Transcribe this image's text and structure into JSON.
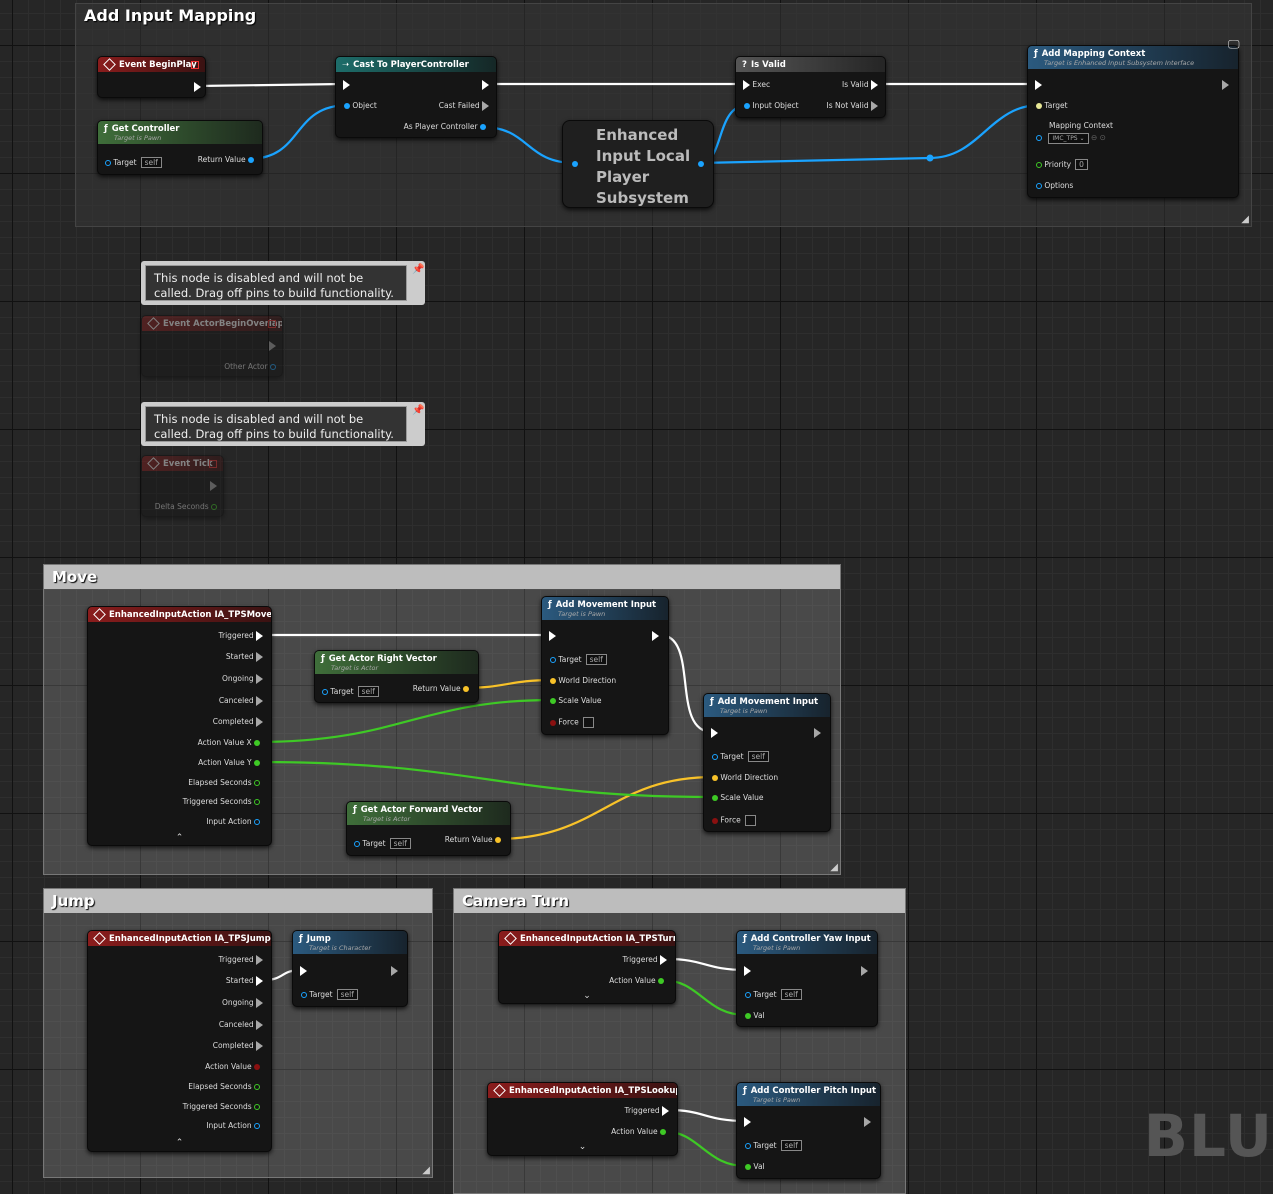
{
  "comments": {
    "input_mapping": "Add Input Mapping",
    "move": "Move",
    "jump": "Jump",
    "camera": "Camera Turn"
  },
  "notes": {
    "disabled1": "This node is disabled and will not be called. Drag off pins to build functionality.",
    "disabled2": "This node is disabled and will not be called. Drag off pins to build functionality."
  },
  "nodes": {
    "begin_play": {
      "title": "Event BeginPlay"
    },
    "get_controller": {
      "title": "Get Controller",
      "subtitle": "Target is Pawn",
      "target": "Target",
      "target_value": "self",
      "return": "Return Value"
    },
    "cast": {
      "title": "Cast To PlayerController",
      "object": "Object",
      "cast_failed": "Cast Failed",
      "as_pc": "As Player Controller"
    },
    "subsystem": {
      "line1": "Enhanced",
      "line2": "Input Local",
      "line3": "Player",
      "line4": "Subsystem"
    },
    "is_valid": {
      "title": "Is Valid",
      "exec": "Exec",
      "is_valid": "Is Valid",
      "input_object": "Input Object",
      "is_not_valid": "Is Not Valid"
    },
    "add_mapping": {
      "title": "Add Mapping Context",
      "subtitle": "Target is Enhanced Input Subsystem Interface",
      "target": "Target",
      "mapping_context": "Mapping Context",
      "context_value": "IMC_TPS",
      "priority": "Priority",
      "priority_value": "0",
      "options": "Options"
    },
    "overlap": {
      "title": "Event ActorBeginOverlap",
      "other_actor": "Other Actor"
    },
    "tick": {
      "title": "Event Tick",
      "delta": "Delta Seconds"
    },
    "move_action": {
      "title": "EnhancedInputAction IA_TPSMove",
      "triggered": "Triggered",
      "started": "Started",
      "ongoing": "Ongoing",
      "canceled": "Canceled",
      "completed": "Completed",
      "value_x": "Action Value X",
      "value_y": "Action Value Y",
      "elapsed": "Elapsed Seconds",
      "triggered_secs": "Triggered Seconds",
      "input_action": "Input Action"
    },
    "right_vector": {
      "title": "Get Actor Right Vector",
      "subtitle": "Target is Actor",
      "target": "Target",
      "target_value": "self",
      "return": "Return Value"
    },
    "add_move1": {
      "title": "Add Movement Input",
      "subtitle": "Target is Pawn",
      "target": "Target",
      "target_value": "self",
      "world_dir": "World Direction",
      "scale": "Scale Value",
      "force": "Force"
    },
    "add_move2": {
      "title": "Add Movement Input",
      "subtitle": "Target is Pawn",
      "target": "Target",
      "target_value": "self",
      "world_dir": "World Direction",
      "scale": "Scale Value",
      "force": "Force"
    },
    "forward_vector": {
      "title": "Get Actor Forward Vector",
      "subtitle": "Target is Actor",
      "target": "Target",
      "target_value": "self",
      "return": "Return Value"
    },
    "jump_action": {
      "title": "EnhancedInputAction IA_TPSJump",
      "triggered": "Triggered",
      "started": "Started",
      "ongoing": "Ongoing",
      "canceled": "Canceled",
      "completed": "Completed",
      "value": "Action Value",
      "elapsed": "Elapsed Seconds",
      "triggered_secs": "Triggered Seconds",
      "input_action": "Input Action"
    },
    "jump": {
      "title": "Jump",
      "subtitle": "Target is Character",
      "target": "Target",
      "target_value": "self"
    },
    "turn_action": {
      "title": "EnhancedInputAction IA_TPSTurn",
      "triggered": "Triggered",
      "value": "Action Value"
    },
    "yaw": {
      "title": "Add Controller Yaw Input",
      "subtitle": "Target is Pawn",
      "target": "Target",
      "target_value": "self",
      "val": "Val"
    },
    "lookup_action": {
      "title": "EnhancedInputAction IA_TPSLookup",
      "triggered": "Triggered",
      "value": "Action Value"
    },
    "pitch": {
      "title": "Add Controller Pitch Input",
      "subtitle": "Target is Pawn",
      "target": "Target",
      "target_value": "self",
      "val": "Val"
    }
  },
  "watermark": "BLU",
  "colors": {
    "exec": "#ffffff",
    "object": "#1aa3ff",
    "float": "#3ec925",
    "vector": "#f8c229",
    "bool": "#8a1010"
  }
}
